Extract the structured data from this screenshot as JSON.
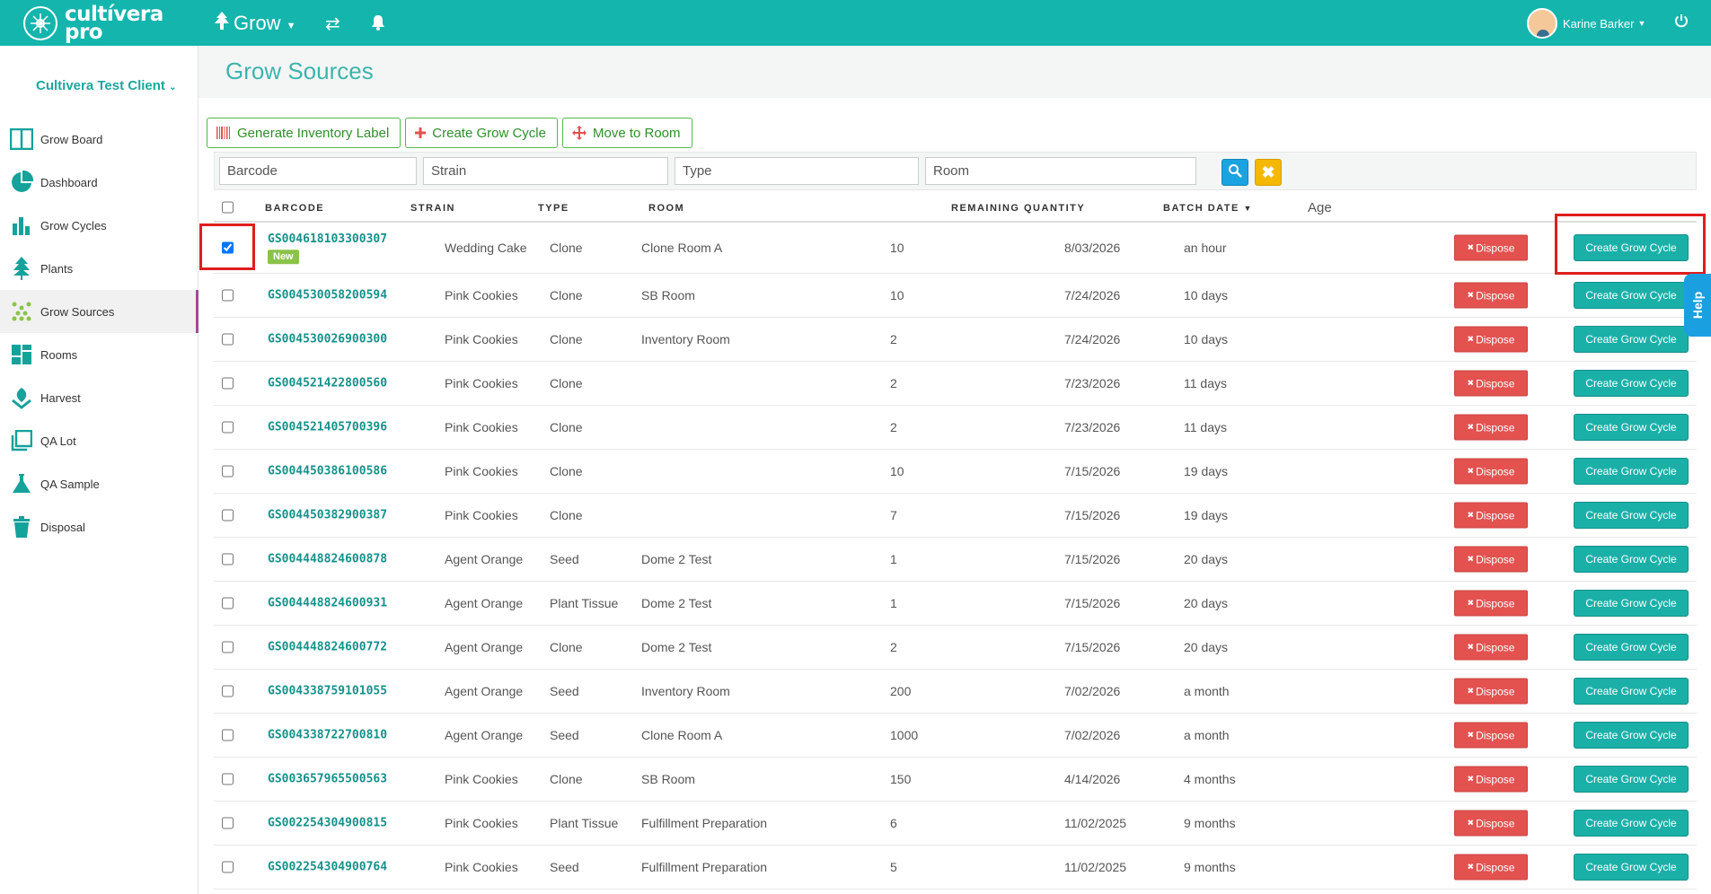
{
  "app": {
    "logo_line1": "cultívera",
    "logo_line2": "pro",
    "module": "Grow",
    "user_name": "Karine Barker"
  },
  "sidebar": {
    "client": "Cultivera Test Client",
    "items": [
      {
        "label": "Grow Board",
        "icon": "grow-board-icon"
      },
      {
        "label": "Dashboard",
        "icon": "dashboard-icon"
      },
      {
        "label": "Grow Cycles",
        "icon": "grow-cycles-icon"
      },
      {
        "label": "Plants",
        "icon": "plants-icon"
      },
      {
        "label": "Grow Sources",
        "icon": "grow-sources-icon",
        "active": true
      },
      {
        "label": "Rooms",
        "icon": "rooms-icon"
      },
      {
        "label": "Harvest",
        "icon": "harvest-icon"
      },
      {
        "label": "QA Lot",
        "icon": "qa-lot-icon"
      },
      {
        "label": "QA Sample",
        "icon": "qa-sample-icon"
      },
      {
        "label": "Disposal",
        "icon": "disposal-icon"
      }
    ]
  },
  "page": {
    "title": "Grow Sources"
  },
  "toolbar": {
    "generate_label": "Generate Inventory Label",
    "create_label": "Create Grow Cycle",
    "move_label": "Move to Room"
  },
  "filters": {
    "barcode_placeholder": "Barcode",
    "strain_placeholder": "Strain",
    "type_placeholder": "Type",
    "room_placeholder": "Room"
  },
  "table": {
    "headers": {
      "barcode": "BARCODE",
      "strain": "STRAIN",
      "type": "TYPE",
      "room": "ROOM",
      "remaining": "REMAINING QUANTITY",
      "batch_date": "BATCH DATE",
      "age": "Age"
    },
    "new_badge": "New",
    "dispose_label": "Dispose",
    "create_label": "Create Grow Cycle",
    "rows": [
      {
        "barcode": "GS004618103300307",
        "strain": "Wedding Cake",
        "type": "Clone",
        "room": "Clone Room A",
        "qty": "10",
        "date": "8/03/2026",
        "age": "an hour",
        "checked": true,
        "is_new": true
      },
      {
        "barcode": "GS004530058200594",
        "strain": "Pink Cookies",
        "type": "Clone",
        "room": "SB Room",
        "qty": "10",
        "date": "7/24/2026",
        "age": "10 days"
      },
      {
        "barcode": "GS004530026900300",
        "strain": "Pink Cookies",
        "type": "Clone",
        "room": "Inventory Room",
        "qty": "2",
        "date": "7/24/2026",
        "age": "10 days"
      },
      {
        "barcode": "GS004521422800560",
        "strain": "Pink Cookies",
        "type": "Clone",
        "room": "",
        "qty": "2",
        "date": "7/23/2026",
        "age": "11 days"
      },
      {
        "barcode": "GS004521405700396",
        "strain": "Pink Cookies",
        "type": "Clone",
        "room": "",
        "qty": "2",
        "date": "7/23/2026",
        "age": "11 days"
      },
      {
        "barcode": "GS004450386100586",
        "strain": "Pink Cookies",
        "type": "Clone",
        "room": "",
        "qty": "10",
        "date": "7/15/2026",
        "age": "19 days"
      },
      {
        "barcode": "GS004450382900387",
        "strain": "Pink Cookies",
        "type": "Clone",
        "room": "",
        "qty": "7",
        "date": "7/15/2026",
        "age": "19 days"
      },
      {
        "barcode": "GS004448824600878",
        "strain": "Agent Orange",
        "type": "Seed",
        "room": "Dome 2 Test",
        "qty": "1",
        "date": "7/15/2026",
        "age": "20 days"
      },
      {
        "barcode": "GS004448824600931",
        "strain": "Agent Orange",
        "type": "Plant Tissue",
        "room": "Dome 2 Test",
        "qty": "1",
        "date": "7/15/2026",
        "age": "20 days"
      },
      {
        "barcode": "GS004448824600772",
        "strain": "Agent Orange",
        "type": "Clone",
        "room": "Dome 2 Test",
        "qty": "2",
        "date": "7/15/2026",
        "age": "20 days"
      },
      {
        "barcode": "GS004338759101055",
        "strain": "Agent Orange",
        "type": "Seed",
        "room": "Inventory Room",
        "qty": "200",
        "date": "7/02/2026",
        "age": "a month"
      },
      {
        "barcode": "GS004338722700810",
        "strain": "Agent Orange",
        "type": "Seed",
        "room": "Clone Room A",
        "qty": "1000",
        "date": "7/02/2026",
        "age": "a month"
      },
      {
        "barcode": "GS003657965500563",
        "strain": "Pink Cookies",
        "type": "Clone",
        "room": "SB Room",
        "qty": "150",
        "date": "4/14/2026",
        "age": "4 months"
      },
      {
        "barcode": "GS002254304900815",
        "strain": "Pink Cookies",
        "type": "Plant Tissue",
        "room": "Fulfillment Preparation",
        "qty": "6",
        "date": "11/02/2025",
        "age": "9 months"
      },
      {
        "barcode": "GS002254304900764",
        "strain": "Pink Cookies",
        "type": "Seed",
        "room": "Fulfillment Preparation",
        "qty": "5",
        "date": "11/02/2025",
        "age": "9 months"
      }
    ]
  },
  "help": {
    "label": "Help"
  },
  "colors": {
    "brand": "#14b5ad",
    "dispose": "#e3524f",
    "highlight": "#e01d1d"
  }
}
